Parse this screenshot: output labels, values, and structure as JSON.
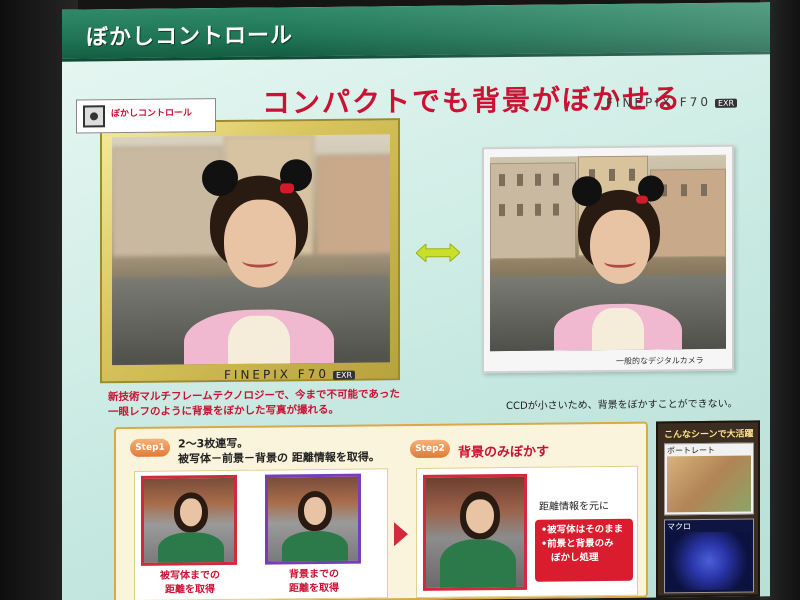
{
  "slide": {
    "header_title": "ぼかしコントロール",
    "main_heading": "コンパクトでも背景がぼかせる",
    "brand_top": "FINEPIX F70",
    "brand_badge": "EXR"
  },
  "left_photo": {
    "label_tag": "ぼかしコントロール",
    "brand": "FINEPIX F70",
    "brand_badge": "EXR"
  },
  "right_photo": {
    "caption": "一般的なデジタルカメラ"
  },
  "descriptions": {
    "left_line1": "新技術マルチフレームテクノロジーで、今まで不可能であった",
    "left_line2": "一眼レフのように背景をぼかした写真が撮れる。",
    "right": "CCDが小さいため、背景をぼかすことができない。"
  },
  "step1": {
    "badge": "Step1",
    "line1": "2～3枚連写。",
    "line2": "被写体－前景－背景の 距離情報を取得。",
    "thumb1_caption_line1": "被写体までの",
    "thumb1_caption_line2": "距離を取得",
    "thumb2_caption_line1": "背景までの",
    "thumb2_caption_line2": "距離を取得"
  },
  "step2": {
    "badge": "Step2",
    "title": "背景のみぼかす",
    "sub": "距離情報を元に",
    "bullet1": "•被写体はそのまま",
    "bullet2": "•前景と背景のみ",
    "bullet3": "ぼかし処理"
  },
  "side_panel": {
    "title": "こんなシーンで大活躍",
    "card1_label": "ポートレート",
    "card2_label": "マクロ"
  },
  "colors": {
    "header_green": "#1f7556",
    "accent_red": "#cc1133",
    "panel_orange": "#d9a84a",
    "arrow_green": "#c8e02a"
  }
}
